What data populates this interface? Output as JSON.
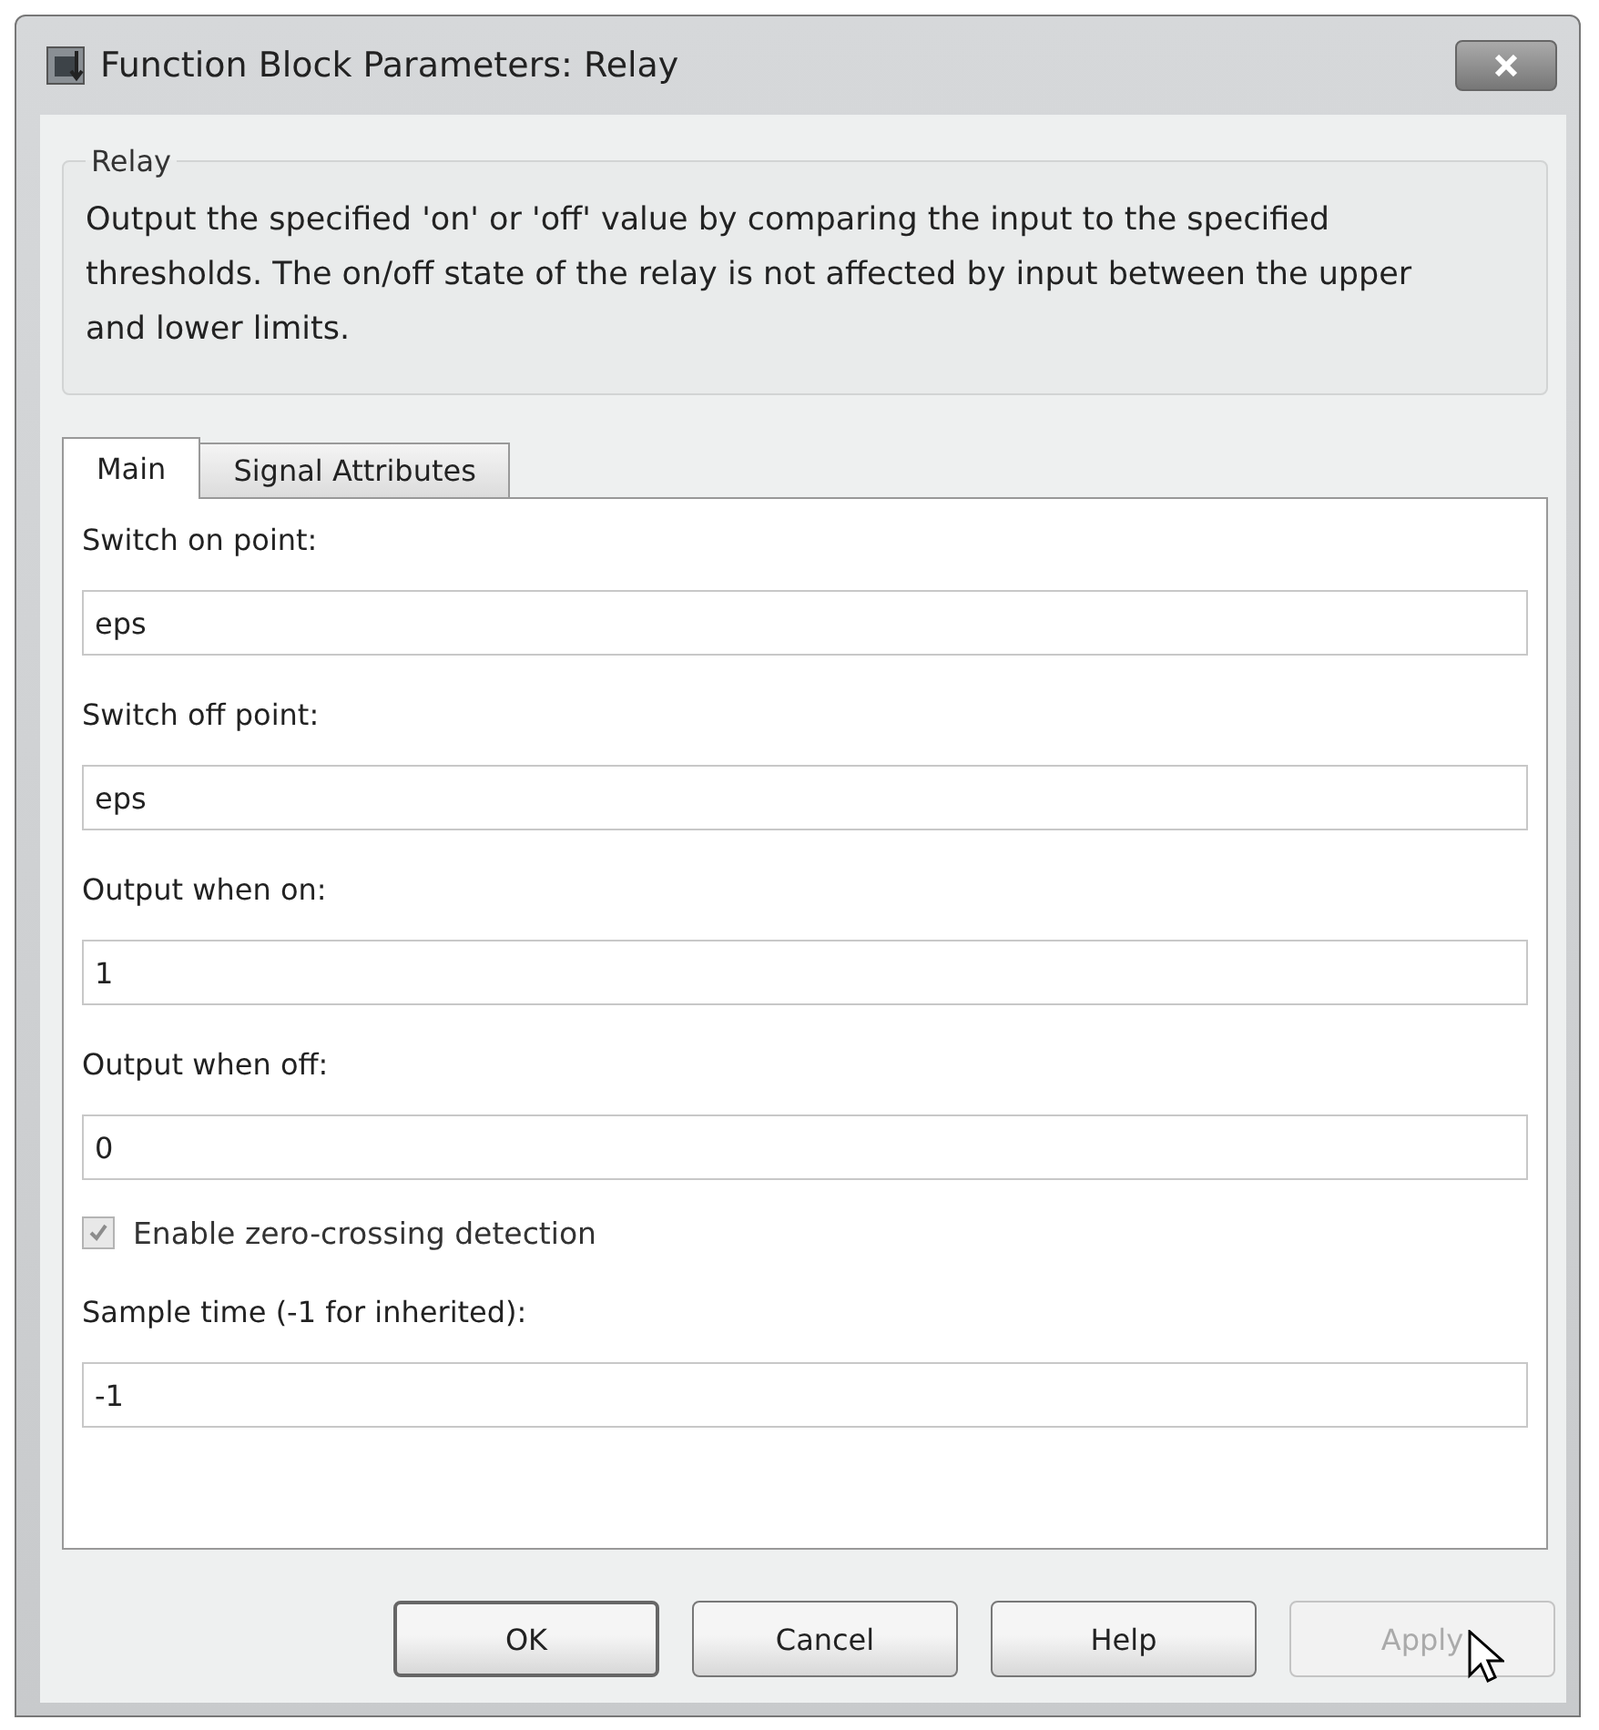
{
  "window": {
    "title": "Function Block Parameters: Relay"
  },
  "group": {
    "title": "Relay",
    "description": "Output the specified 'on' or 'off' value by comparing the input to the specified thresholds.  The on/off state of the relay is not affected by input between the upper and lower limits."
  },
  "tabs": [
    {
      "label": "Main",
      "selected": true
    },
    {
      "label": "Signal Attributes",
      "selected": false
    }
  ],
  "parameters": [
    {
      "kind": "field",
      "label": "Switch on point:",
      "value": "eps"
    },
    {
      "kind": "field",
      "label": "Switch off point:",
      "value": "eps"
    },
    {
      "kind": "field",
      "label": "Output when on:",
      "value": "1"
    },
    {
      "kind": "field",
      "label": "Output when off:",
      "value": "0"
    },
    {
      "kind": "checkbox",
      "label": "Enable zero-crossing detection",
      "checked": true,
      "disabled": true
    },
    {
      "kind": "field",
      "label": "Sample time (-1 for inherited):",
      "value": "-1"
    }
  ],
  "buttons": [
    {
      "label": "OK",
      "disabled": false,
      "default": true
    },
    {
      "label": "Cancel",
      "disabled": false,
      "default": false
    },
    {
      "label": "Help",
      "disabled": false,
      "default": false
    },
    {
      "label": "Apply",
      "disabled": true,
      "default": false
    }
  ]
}
